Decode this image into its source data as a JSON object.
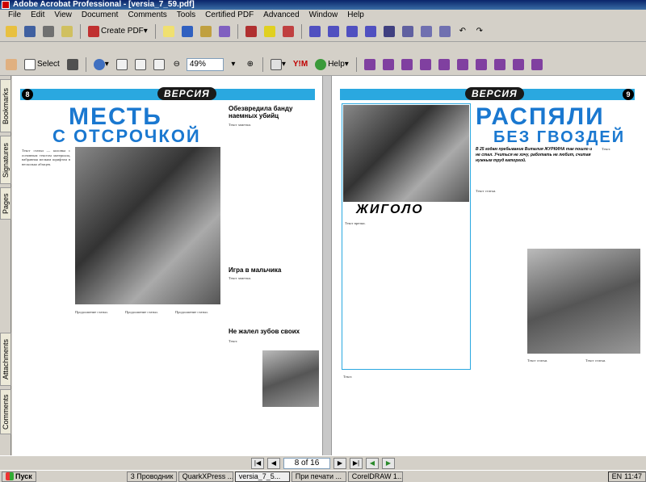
{
  "window": {
    "title": "Adobe Acrobat Professional - [versia_7_59.pdf]"
  },
  "menu": [
    "File",
    "Edit",
    "View",
    "Document",
    "Comments",
    "Tools",
    "Certified PDF",
    "Advanced",
    "Window",
    "Help"
  ],
  "toolbar": {
    "create_pdf": "Create PDF",
    "select": "Select",
    "zoom_value": "49%",
    "help": "Help"
  },
  "sidetabs": [
    "Bookmarks",
    "Signatures",
    "Pages",
    "Attachments",
    "Comments"
  ],
  "spread": {
    "left_page_number": "8",
    "right_page_number": "9",
    "brand": "ВЕРСИЯ",
    "left_headline_1": "МЕСТЬ",
    "left_headline_2": "С ОТСРОЧКОЙ",
    "left_col2_title": "Обезвредила банду наемных убийц",
    "left_col2_section": "Игра в мальчика",
    "left_col2_section2": "Не жалел зубов своих",
    "right_headline_1": "РАСПЯЛИ",
    "right_headline_2": "БЕЗ ГВОЗДЕЙ",
    "right_sub": "ЖИГОЛО",
    "right_lead": "В 25 годам пребывание Виталия ЖУРКИНА так пошло и не стал. Учиться не хочу, работать не любит, считая нужным труд каторгой."
  },
  "nav": {
    "page_field": "8 of 16"
  },
  "taskbar": {
    "start": "Пуск",
    "tasks": [
      "3 Проводник",
      "QuarkXPress ...",
      "versia_7_5...",
      "При печати ...",
      "CorelDRAW 1..."
    ],
    "lang": "EN",
    "clock": "11:47"
  }
}
